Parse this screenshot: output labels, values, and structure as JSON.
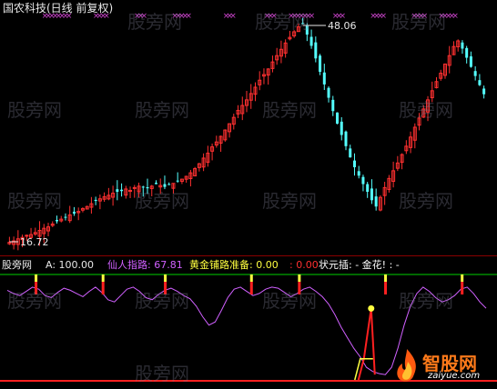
{
  "chart_title": "国农科技(日线 前复权)",
  "price_max_label": "48.06",
  "price_min_label": "16.72",
  "indicator": {
    "name": "股旁网",
    "a_label": "A: 100.00",
    "xianren_label": "仙人指路: 67.81",
    "huangjin_label": "黄金铺路准备: 0.00",
    "zero_label": ": 0.00",
    "zhuangyuan_label": "状元插: - 金花! : -"
  },
  "watermarks": [
    "股旁网",
    "股旁网",
    "股旁网",
    "股旁网",
    "股旁网",
    "股旁网",
    "股旁网",
    "股旁网",
    "股旁网",
    "股旁网",
    "股旁网",
    "股旁网",
    "股旁网",
    "股旁网",
    "股旁网",
    "股旁网"
  ],
  "logo": {
    "main": "智股网",
    "sub": "zaiyue.com"
  },
  "colors": {
    "up": "#ff3030",
    "down": "#54ffff",
    "line": "#d060ff",
    "ref": "#00d000",
    "marker": "#cc44cc",
    "signal": "#ffff40"
  },
  "chart_data": {
    "type": "candlestick",
    "ylim": [
      16.72,
      48.06
    ],
    "x_markers": [
      10,
      11,
      12,
      13,
      14,
      15,
      16,
      17,
      25,
      26,
      27,
      28,
      37,
      38,
      39,
      48,
      49,
      50,
      51,
      52,
      63,
      64,
      65,
      75,
      76,
      77,
      82,
      83,
      84,
      85,
      86,
      87,
      88,
      95,
      96,
      97,
      106,
      107,
      108,
      109,
      118,
      119,
      120,
      121,
      126,
      127,
      128,
      129,
      130
    ],
    "candles_close": [
      16.9,
      17.1,
      17.4,
      17.6,
      17.9,
      18.0,
      18.3,
      18.6,
      18.9,
      19.1,
      19.5,
      19.9,
      20.2,
      20.5,
      20.8,
      21.0,
      21.3,
      21.7,
      22.0,
      22.4,
      22.8,
      23.1,
      23.4,
      23.6,
      23.9,
      24.1,
      24.2,
      24.5,
      24.3,
      24.7,
      24.9,
      24.8,
      24.6,
      24.9,
      25.2,
      25.0,
      24.8,
      25.1,
      25.3,
      25.6,
      25.9,
      26.3,
      26.8,
      27.4,
      28.1,
      28.9,
      29.6,
      30.5,
      31.2,
      32.0,
      32.9,
      33.8,
      34.7,
      35.7,
      36.4,
      37.2,
      38.1,
      39.0,
      40.0,
      40.8,
      41.6,
      42.6,
      43.5,
      44.4,
      45.3,
      46.1,
      46.9,
      47.6,
      48.0,
      46.5,
      44.9,
      43.1,
      41.2,
      39.4,
      37.5,
      35.6,
      33.8,
      32.2,
      30.6,
      29.0,
      27.6,
      26.4,
      25.2,
      24.1,
      22.9,
      22.0,
      23.3,
      24.7,
      26.0,
      27.1,
      28.2,
      29.4,
      30.6,
      31.9,
      33.3,
      34.6,
      35.9,
      37.2,
      38.5,
      39.8,
      41.0,
      42.3,
      43.5,
      44.8,
      45.6,
      44.5,
      43.2,
      41.9,
      40.6,
      39.3,
      38.0
    ],
    "indicator_line": [
      85,
      82,
      80,
      84,
      88,
      86,
      80,
      78,
      83,
      87,
      85,
      82,
      79,
      84,
      88,
      83,
      76,
      74,
      80,
      86,
      88,
      84,
      78,
      76,
      81,
      85,
      87,
      84,
      80,
      77,
      70,
      60,
      52,
      55,
      66,
      78,
      86,
      88,
      84,
      80,
      82,
      86,
      88,
      87,
      83,
      79,
      82,
      86,
      88,
      84,
      79,
      72,
      62,
      50,
      40,
      30,
      22,
      12,
      8,
      6,
      5,
      12,
      30,
      52,
      70,
      82,
      88,
      84,
      78,
      74,
      76,
      80,
      86,
      88,
      82,
      74,
      68
    ],
    "indicator_ylim": [
      0,
      100
    ],
    "signal_bars": [
      0.06,
      0.2,
      0.33,
      0.51,
      0.61,
      0.79,
      0.95
    ],
    "spike_value": 67.81
  }
}
